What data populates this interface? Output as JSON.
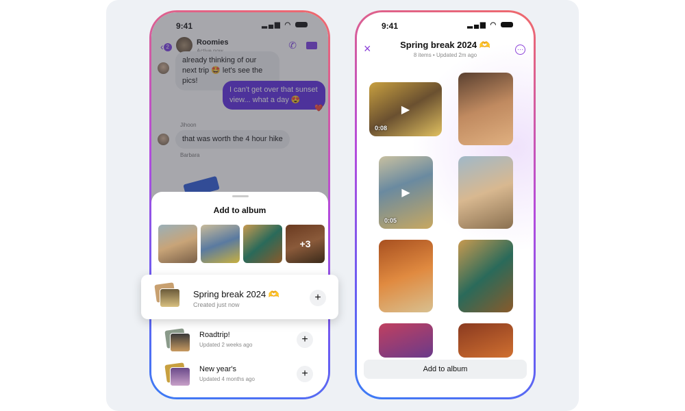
{
  "status": {
    "time": "9:41"
  },
  "chat": {
    "title": "Roomies",
    "subtitle": "Active now",
    "unread": "2",
    "messages": [
      {
        "text": "already thinking of our next trip 🤩 let's see the pics!"
      },
      {
        "text": "I can't get over that sunset view... what a day 😍",
        "reaction": "❤️"
      },
      {
        "sender": "Jihoon",
        "text": "that was worth the 4 hour hike"
      },
      {
        "sender": "Barbara"
      }
    ]
  },
  "sheet": {
    "title": "Add to album",
    "more_count": "+3",
    "albums": [
      {
        "name": "Spring break 2024 🫶",
        "subtitle": "Created just now",
        "action": "+"
      },
      {
        "name": "Roadtrip!",
        "subtitle": "Updated 2 weeks ago",
        "action": "+"
      },
      {
        "name": "New year's",
        "subtitle": "Updated 4 months ago",
        "action": "+"
      }
    ]
  },
  "album": {
    "title": "Spring break 2024 🫶",
    "subtitle": "8 items • Updated 2m ago",
    "close_icon": "×",
    "more_icon": "⋯",
    "tiles": [
      {
        "duration": "0:08",
        "video": true
      },
      {
        "video": false
      },
      {
        "duration": "0:05",
        "video": true
      },
      {
        "video": false
      },
      {
        "video": false
      },
      {
        "video": false
      },
      {
        "video": false
      },
      {
        "video": false
      }
    ],
    "add_button": "Add to album"
  },
  "colors": {
    "accent": "#7b3fe4",
    "bubble_out": "#5b2be0"
  }
}
